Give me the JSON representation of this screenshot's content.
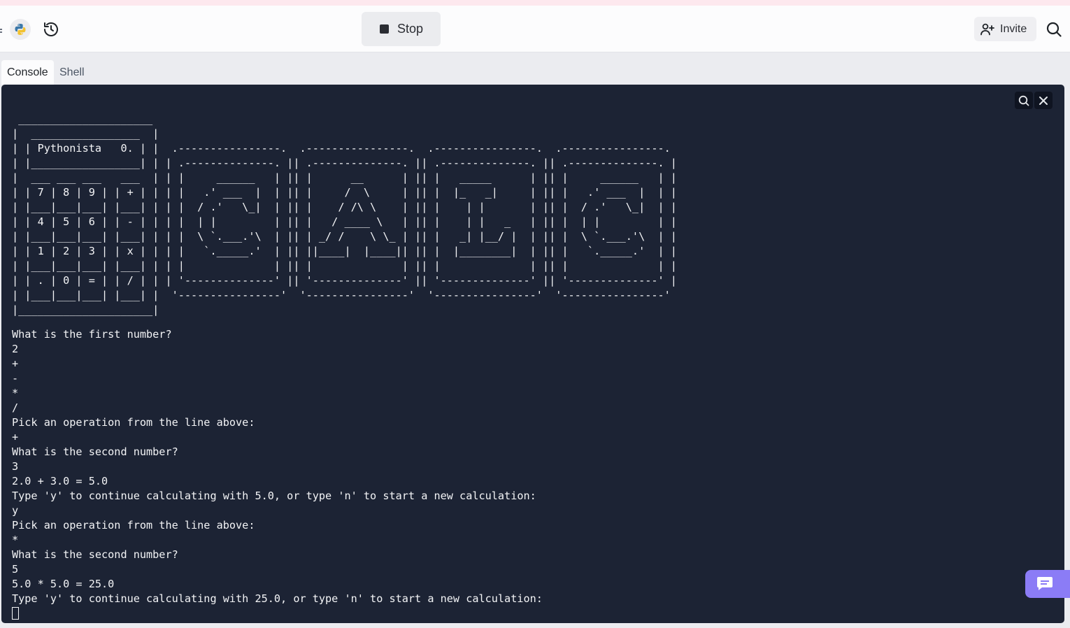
{
  "header": {
    "stop_label": "Stop",
    "invite_label": "Invite",
    "icons": [
      "python-icon",
      "history-icon",
      "stop-icon",
      "add-user-icon",
      "search-icon"
    ]
  },
  "tabs": [
    {
      "label": "Console",
      "active": true
    },
    {
      "label": "Shell",
      "active": false
    }
  ],
  "console": {
    "ascii_art": " _____________________\n|  _________________  |\n| | Pythonista   0. | |  .----------------.  .----------------.  .----------------.  .----------------.\n| |_________________| | | .--------------. || .--------------. || .--------------. || .--------------. |\n|  ___ ___ ___   ___  | | |     ______   | || |      __      | || |   _____      | || |     ______   | |\n| | 7 | 8 | 9 | | + | | | |   .' ___  |  | || |     /  \\     | || |  |_   _|     | || |   .' ___  |  | |\n| |___|___|___| |___| | | |  / .'   \\_|  | || |    / /\\ \\    | || |    | |       | || |  / .'   \\_|  | |\n| | 4 | 5 | 6 | | - | | | |  | |         | || |   / ____ \\   | || |    | |   _   | || |  | |         | |\n| |___|___|___| |___| | | |  \\ `.___.'\\  | || | _/ /    \\ \\_ | || |   _| |__/ |  | || |  \\ `.___.'\\  | |\n| | 1 | 2 | 3 | | x | | | |   `._____.'  | || ||____|  |____|| || |  |________|  | || |   `._____.'  | |\n| |___|___|___| |___| | | |              | || |              | || |              | || |              | |\n| | . | 0 | = | | / | | | '--------------' || '--------------' || '--------------' || '--------------' |\n| |___|___|___| |___| |  '----------------'  '----------------'  '----------------'  '----------------'\n|_____________________|",
    "lines": [
      "What is the first number?",
      "2",
      "+",
      "-",
      "*",
      "/",
      "Pick an operation from the line above:",
      "+",
      "What is the second number?",
      "3",
      "2.0 + 3.0 = 5.0",
      "Type 'y' to continue calculating with 5.0, or type 'n' to start a new calculation:",
      "y",
      "Pick an operation from the line above:",
      "*",
      "What is the second number?",
      "5",
      "5.0 * 5.0 = 25.0",
      "Type 'y' to continue calculating with 25.0, or type 'n' to start a new calculation:"
    ]
  }
}
